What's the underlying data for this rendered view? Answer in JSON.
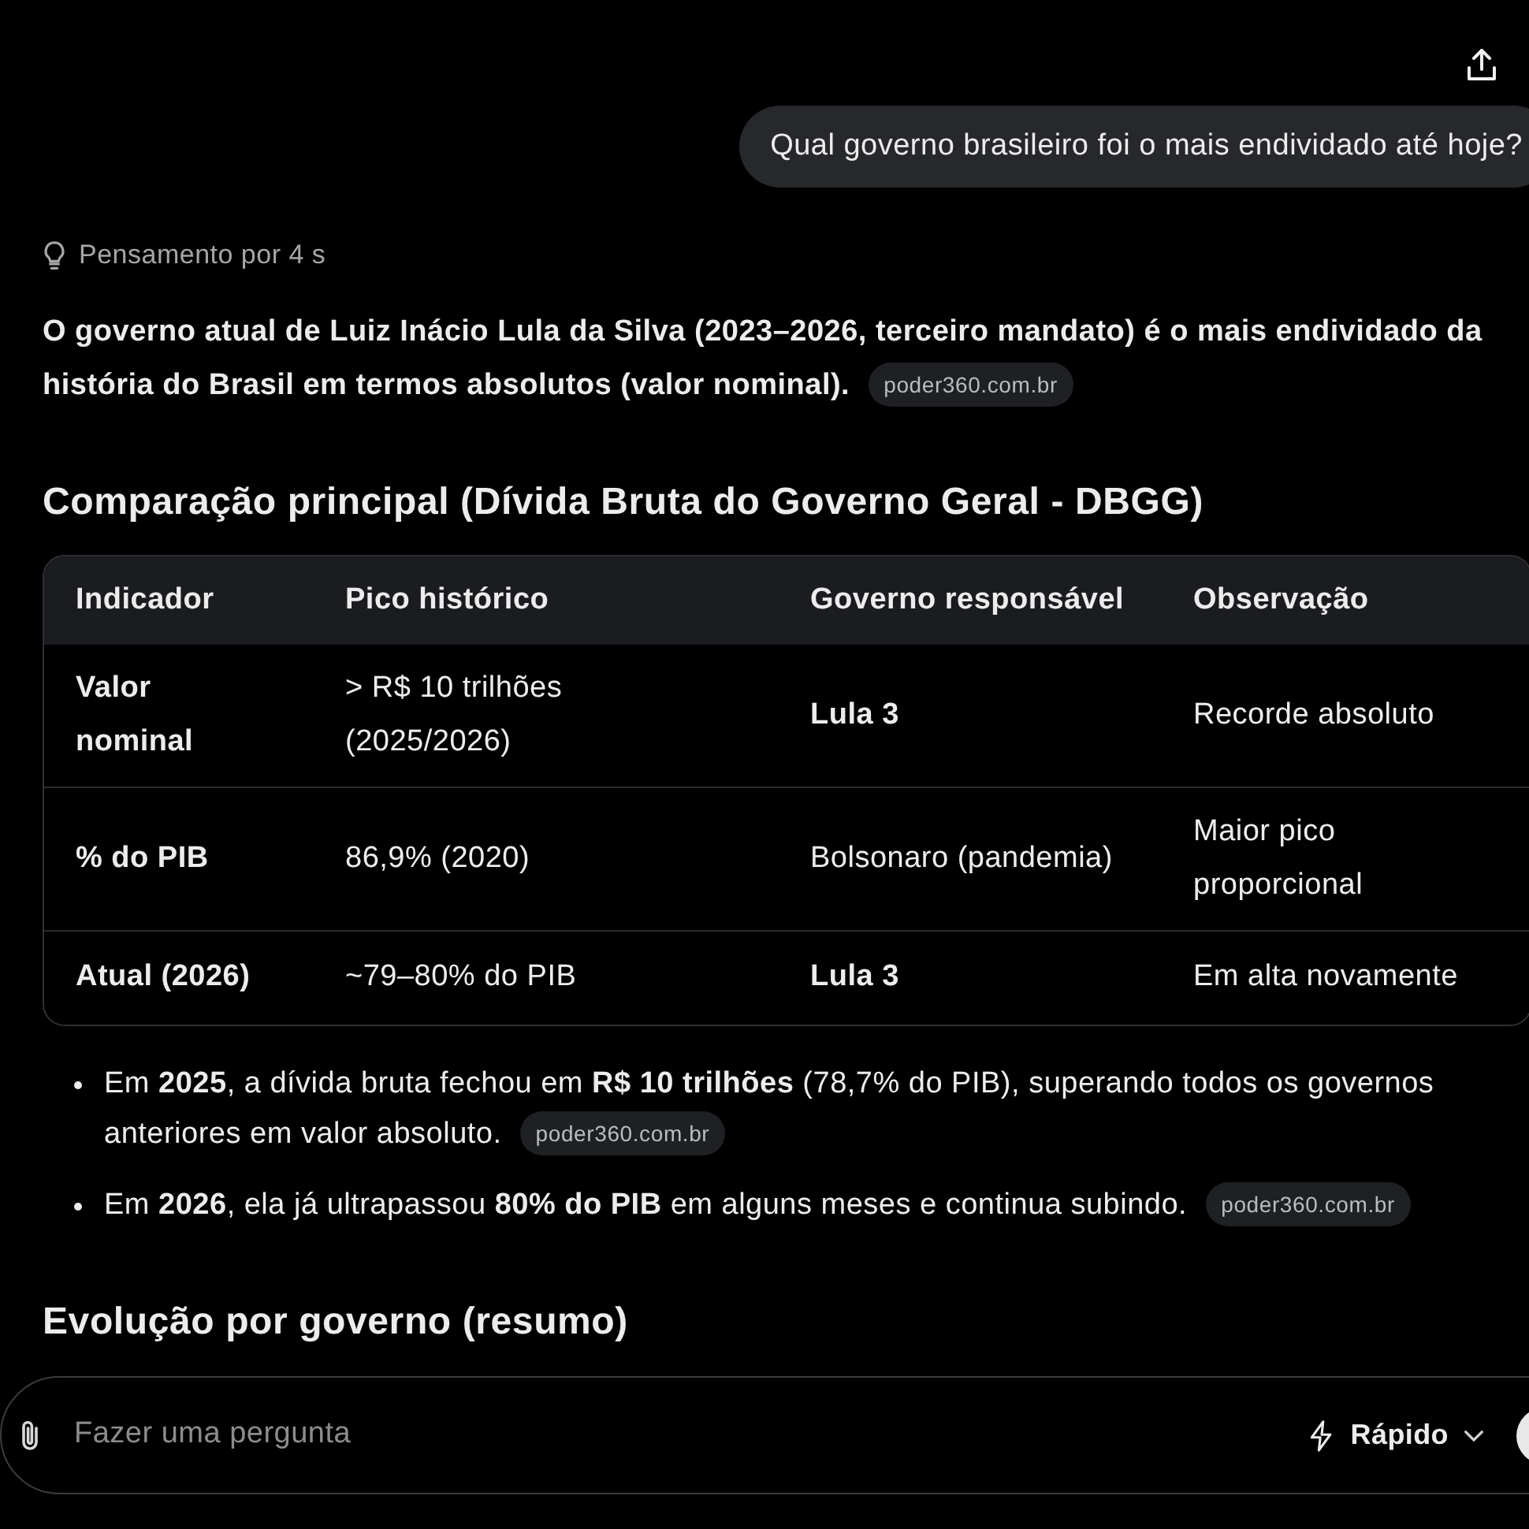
{
  "user_message": {
    "text": "Qual governo brasileiro foi o mais endividado até hoje?"
  },
  "thinking": {
    "label": "Pensamento por 4 s"
  },
  "intro": {
    "text": "O governo atual de Luiz Inácio Lula da Silva (2023–2026, terceiro mandato) é o mais endividado da história do Brasil em termos absolutos (valor nominal).",
    "source": "poder360.com.br"
  },
  "sections": [
    {
      "heading": "Comparação principal (Dívida Bruta do Governo Geral - DBGG)",
      "table": {
        "columns": [
          "Indicador",
          "Pico histórico",
          "Governo responsável",
          "Observação"
        ],
        "rows": [
          [
            {
              "text": "Valor nominal",
              "bold": true
            },
            {
              "text": "> R$ 10 trilhões (2025/2026)",
              "bold": false
            },
            {
              "text": "Lula 3",
              "bold": true
            },
            {
              "text": "Recorde absoluto",
              "bold": false
            }
          ],
          [
            {
              "text": "% do PIB",
              "bold": true
            },
            {
              "text": "86,9% (2020)",
              "bold": false
            },
            {
              "text": "Bolsonaro (pandemia)",
              "bold": false
            },
            {
              "text": "Maior pico proporcional",
              "bold": false
            }
          ],
          [
            {
              "text": "Atual (2026)",
              "bold": true
            },
            {
              "text": "~79–80% do PIB",
              "bold": false
            },
            {
              "text": "Lula 3",
              "bold": true
            },
            {
              "text": "Em alta novamente",
              "bold": false
            }
          ]
        ]
      },
      "bullets": [
        {
          "text": "Em **2025**, a dívida bruta fechou em **R$ 10 trilhões** (78,7% do PIB), superando todos os governos anteriores em valor absoluto.",
          "source": "poder360.com.br"
        },
        {
          "text": "Em **2026**, ela já ultrapassou **80% do PIB** em alguns meses e continua subindo.",
          "source": "poder360.com.br"
        }
      ]
    },
    {
      "heading": "Evolução por governo (resumo)"
    }
  ],
  "composer": {
    "placeholder": "Fazer uma pergunta",
    "mode": "Rápido"
  }
}
